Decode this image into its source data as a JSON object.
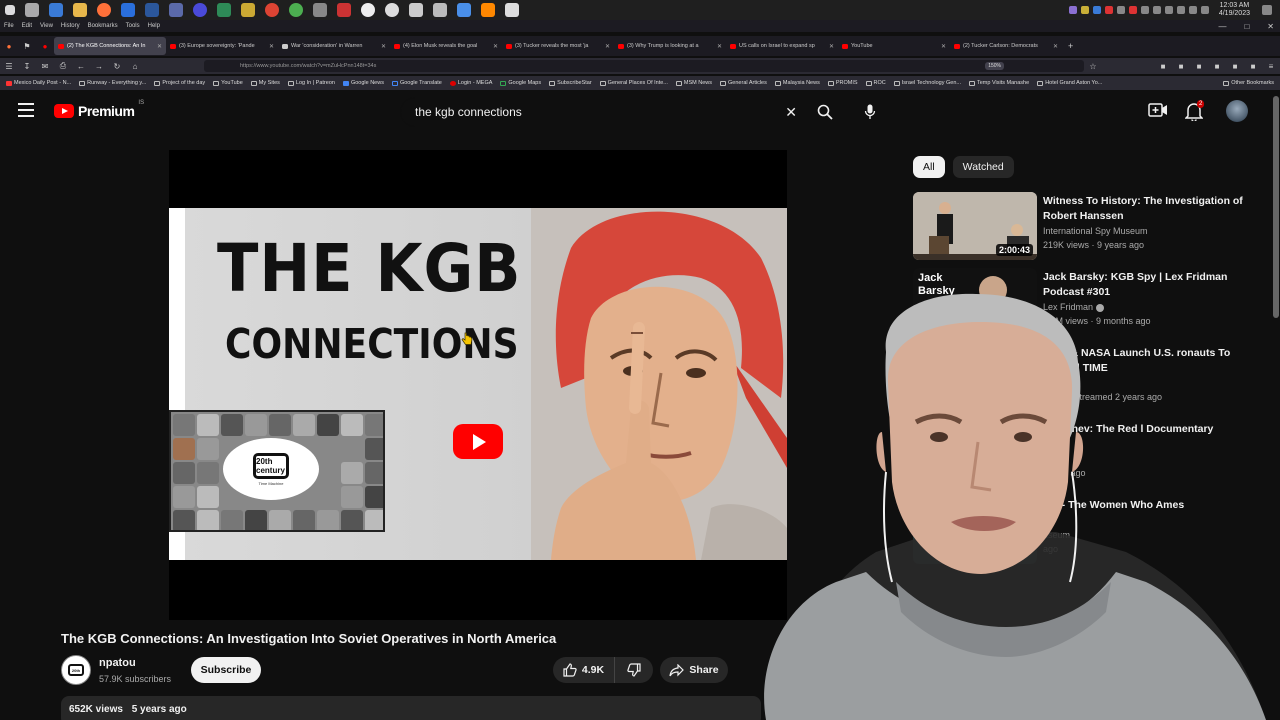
{
  "os": {
    "clock_time": "12:03 AM",
    "clock_date": "4/19/2023"
  },
  "menu": [
    "File",
    "Edit",
    "View",
    "History",
    "Bookmarks",
    "Tools",
    "Help"
  ],
  "tabs": [
    {
      "label": "(2) The KGB Connections: An In",
      "active": true
    },
    {
      "label": "(3) Europe sovereignty: 'Pande",
      "active": false
    },
    {
      "label": "War 'consideration' in Warren",
      "active": false
    },
    {
      "label": "(4) Elon Musk reveals the goal",
      "active": false
    },
    {
      "label": "(3) Tucker reveals the most 'ja",
      "active": false
    },
    {
      "label": "(3) Why Trump is looking at a",
      "active": false
    },
    {
      "label": "US calls on Israel to expand sp",
      "active": false
    },
    {
      "label": "YouTube",
      "active": false
    },
    {
      "label": "(2) Tucker Carlson: Democrats",
      "active": false
    }
  ],
  "address_bar": {
    "url": "https://www.youtube.com/watch?v=mZuHcPnn148t=34s",
    "zoom": "150%"
  },
  "bookmarks": [
    "Mexico Daily Post - N...",
    "Runway - Everything y...",
    "Project of the day",
    "YouTube",
    "My Sites",
    "Log In | Patreon",
    "Google News",
    "Google Translate",
    "Login - MEGA",
    "Google Maps",
    "SubscribeStar",
    "General Places Of Inte...",
    "MSM News",
    "General Articles",
    "Malaysia News",
    "PROMIS",
    "ROC",
    "Israel Technology Gen...",
    "Temp Visits Manashe",
    "Hotel Grand Aston Yo...",
    "Other Bookmarks"
  ],
  "header": {
    "logo_text": "Premium",
    "logo_region": "IS",
    "search_query": "the kgb connections",
    "notification_count": "2"
  },
  "thumbnail": {
    "title_line1": "THE KGB",
    "title_line2": "CONNECTIONS",
    "badge_label": "20th century",
    "badge_sub": "Time Machine"
  },
  "video": {
    "title": "The KGB Connections: An Investigation Into Soviet Operatives in North America",
    "channel_name": "npatou",
    "subscribers": "57.9K subscribers",
    "subscribe_label": "Subscribe",
    "likes": "4.9K",
    "share_label": "Share",
    "views": "652K views",
    "age": "5 years ago"
  },
  "chips": [
    "All",
    "Watched"
  ],
  "recommendations": [
    {
      "title": "Witness To History: The Investigation of Robert Hanssen",
      "channel": "International Spy Museum",
      "meta": "219K views · 9 years ago",
      "duration": "2:00:43",
      "verified": false
    },
    {
      "title": "Jack Barsky: KGB Spy | Lex Fridman Podcast #301",
      "channel": "Lex Fridman",
      "meta": "3.5M views · 9 months ago",
      "duration": "",
      "verified": true,
      "thumb_text": "Jack Barsky"
    },
    {
      "title": "aceX & NASA Launch U.S. ronauts To Space | TIME",
      "channel": "",
      "meta": "views · Streamed 2 years ago",
      "duration": "",
      "verified": true
    },
    {
      "title": "rushchev: The Red l Documentary",
      "channel": "",
      "meta": "1 year ago",
      "duration": "",
      "verified": true
    },
    {
      "title": "ers - The Women Who Ames",
      "channel": "useum",
      "meta": "ago",
      "duration": "",
      "verified": false
    }
  ],
  "colors": {
    "background": "#0f0f0f",
    "accent": "#ff0000",
    "chip_bg": "#272727"
  }
}
